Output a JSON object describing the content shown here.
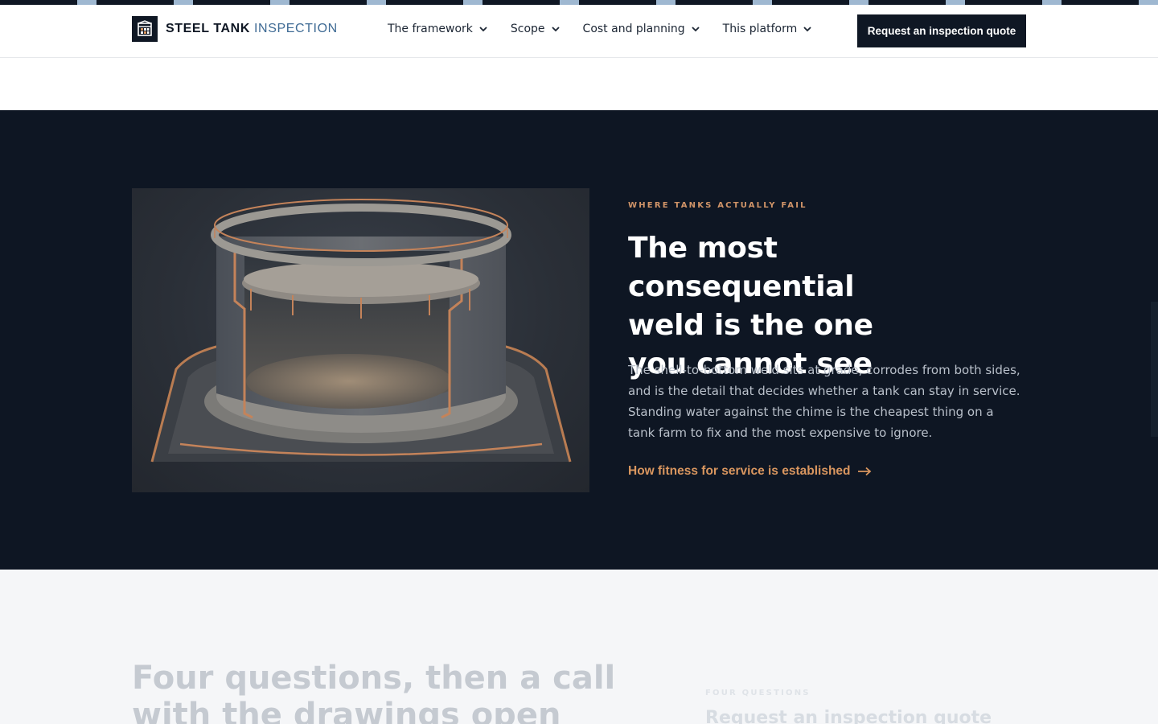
{
  "colors": {
    "navy": "#0f1724",
    "dark_section": "#0e1623",
    "accent_copper": "#d9965f",
    "logo_blue": "#3e6a94",
    "stripe_light": "#9fb8d1"
  },
  "header": {
    "logo_strong": "STEEL TANK",
    "logo_light": "INSPECTION",
    "nav": [
      {
        "label": "The framework",
        "icon": "chevron-down-icon"
      },
      {
        "label": "Scope",
        "icon": "chevron-down-icon"
      },
      {
        "label": "Cost and planning",
        "icon": "chevron-down-icon"
      },
      {
        "label": "This platform",
        "icon": "chevron-down-icon"
      }
    ],
    "cta_label": "Request an inspection quote"
  },
  "feature": {
    "eyebrow": "WHERE TANKS ACTUALLY FAIL",
    "headline_lines": [
      "The most consequential",
      "weld is the one",
      "you cannot see"
    ],
    "body": "The shell-to-bottom weld sits at grade, corrodes from both sides, and is the detail that decides whether a tank can stay in service. Standing water against the chime is the cheapest thing on a tank farm to fix and the most expensive to ignore.",
    "link_label": "How fitness for service is established",
    "link_icon": "arrow-right-icon",
    "image_icon": "tank-cutaway-illustration"
  },
  "next_section": {
    "title_lines": [
      "Four questions, then a call",
      "with the drawings open"
    ],
    "eyebrow": "FOUR QUESTIONS",
    "subtitle": "Request an inspection quote"
  }
}
